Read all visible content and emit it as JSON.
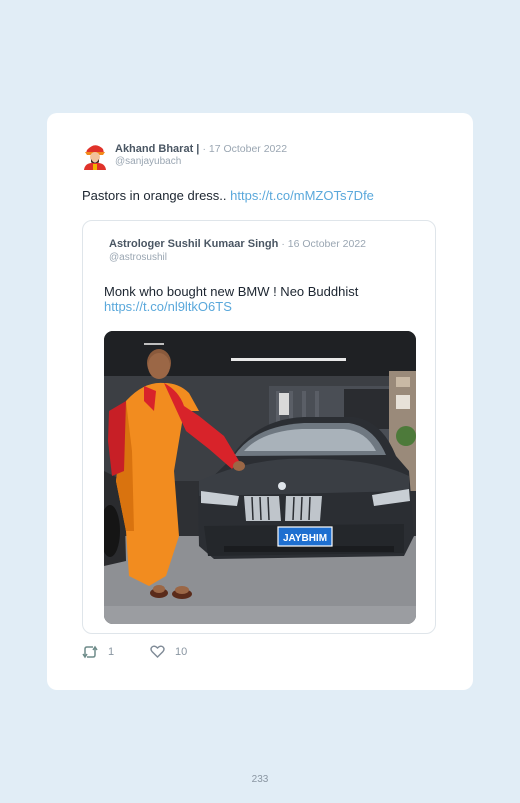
{
  "tweet": {
    "author_name": "Akhand Bharat |",
    "date": "· 17 October 2022",
    "handle": "@sanjayubach",
    "text": "Pastors in orange dress..",
    "link": "https://t.co/mMZOTs7Dfe",
    "retweets": "1",
    "likes": "10"
  },
  "quoted_tweet": {
    "author_name": "Astrologer Sushil Kumaar Singh",
    "date": "· 16 October 2022",
    "handle": "@astrosushil",
    "text": "Monk who bought new BMW ! Neo Buddhist",
    "link": "https://t.co/nl9ltkO6TS",
    "photo": {
      "plate_text": "JAYBHIM"
    }
  },
  "icons": {
    "retweet": "retweet-icon",
    "like": "heart-icon"
  },
  "page_number": "233"
}
